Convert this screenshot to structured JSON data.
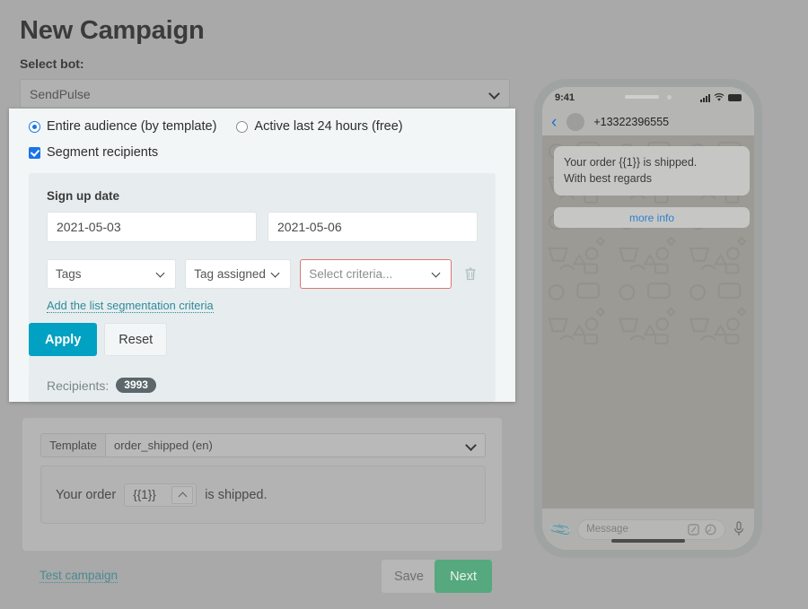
{
  "page": {
    "title": "New Campaign",
    "select_bot_label": "Select bot:",
    "bot_value": "SendPulse"
  },
  "audience": {
    "option_entire": "Entire audience (by template)",
    "option_active": "Active last 24 hours (free)",
    "segment_checkbox_label": "Segment recipients"
  },
  "segmentation": {
    "signup_date_label": "Sign up date",
    "date_from": "2021-05-03",
    "date_to": "2021-05-06",
    "filter_field": "Tags",
    "filter_condition": "Tag assigned",
    "filter_value_placeholder": "Select criteria...",
    "delete_icon": "trash-icon",
    "add_criteria_link": "Add the list segmentation criteria",
    "apply_label": "Apply",
    "reset_label": "Reset",
    "recipients_label": "Recipients:",
    "recipients_count": "3993",
    "error_border_color": "#d9786f",
    "accent_color": "#00a1c2",
    "link_color": "#2e8b9b"
  },
  "template": {
    "label": "Template",
    "selected": "order_shipped (en)",
    "body_prefix": "Your order",
    "variable": "{{1}}",
    "body_suffix": "is shipped."
  },
  "footer": {
    "test_campaign": "Test campaign",
    "save_label": "Save",
    "next_label": "Next",
    "next_color": "#56a87e"
  },
  "phone": {
    "status_time": "9:41",
    "signal_icon": "cellular-signal-icon",
    "wifi_icon": "wifi-icon",
    "battery_icon": "battery-icon",
    "back_icon": "back-chevron-icon",
    "avatar_icon": "contact-avatar",
    "contact": "+13322396555",
    "message_line1": "Your order {{1}} is shipped.",
    "message_line2": "With best regards",
    "cta_label": "more info",
    "attach_icon": "paperclip-icon",
    "input_placeholder": "Message",
    "sticker_icon": "sticker-icon",
    "timer_icon": "disappearing-timer-icon",
    "mic_icon": "microphone-icon"
  }
}
